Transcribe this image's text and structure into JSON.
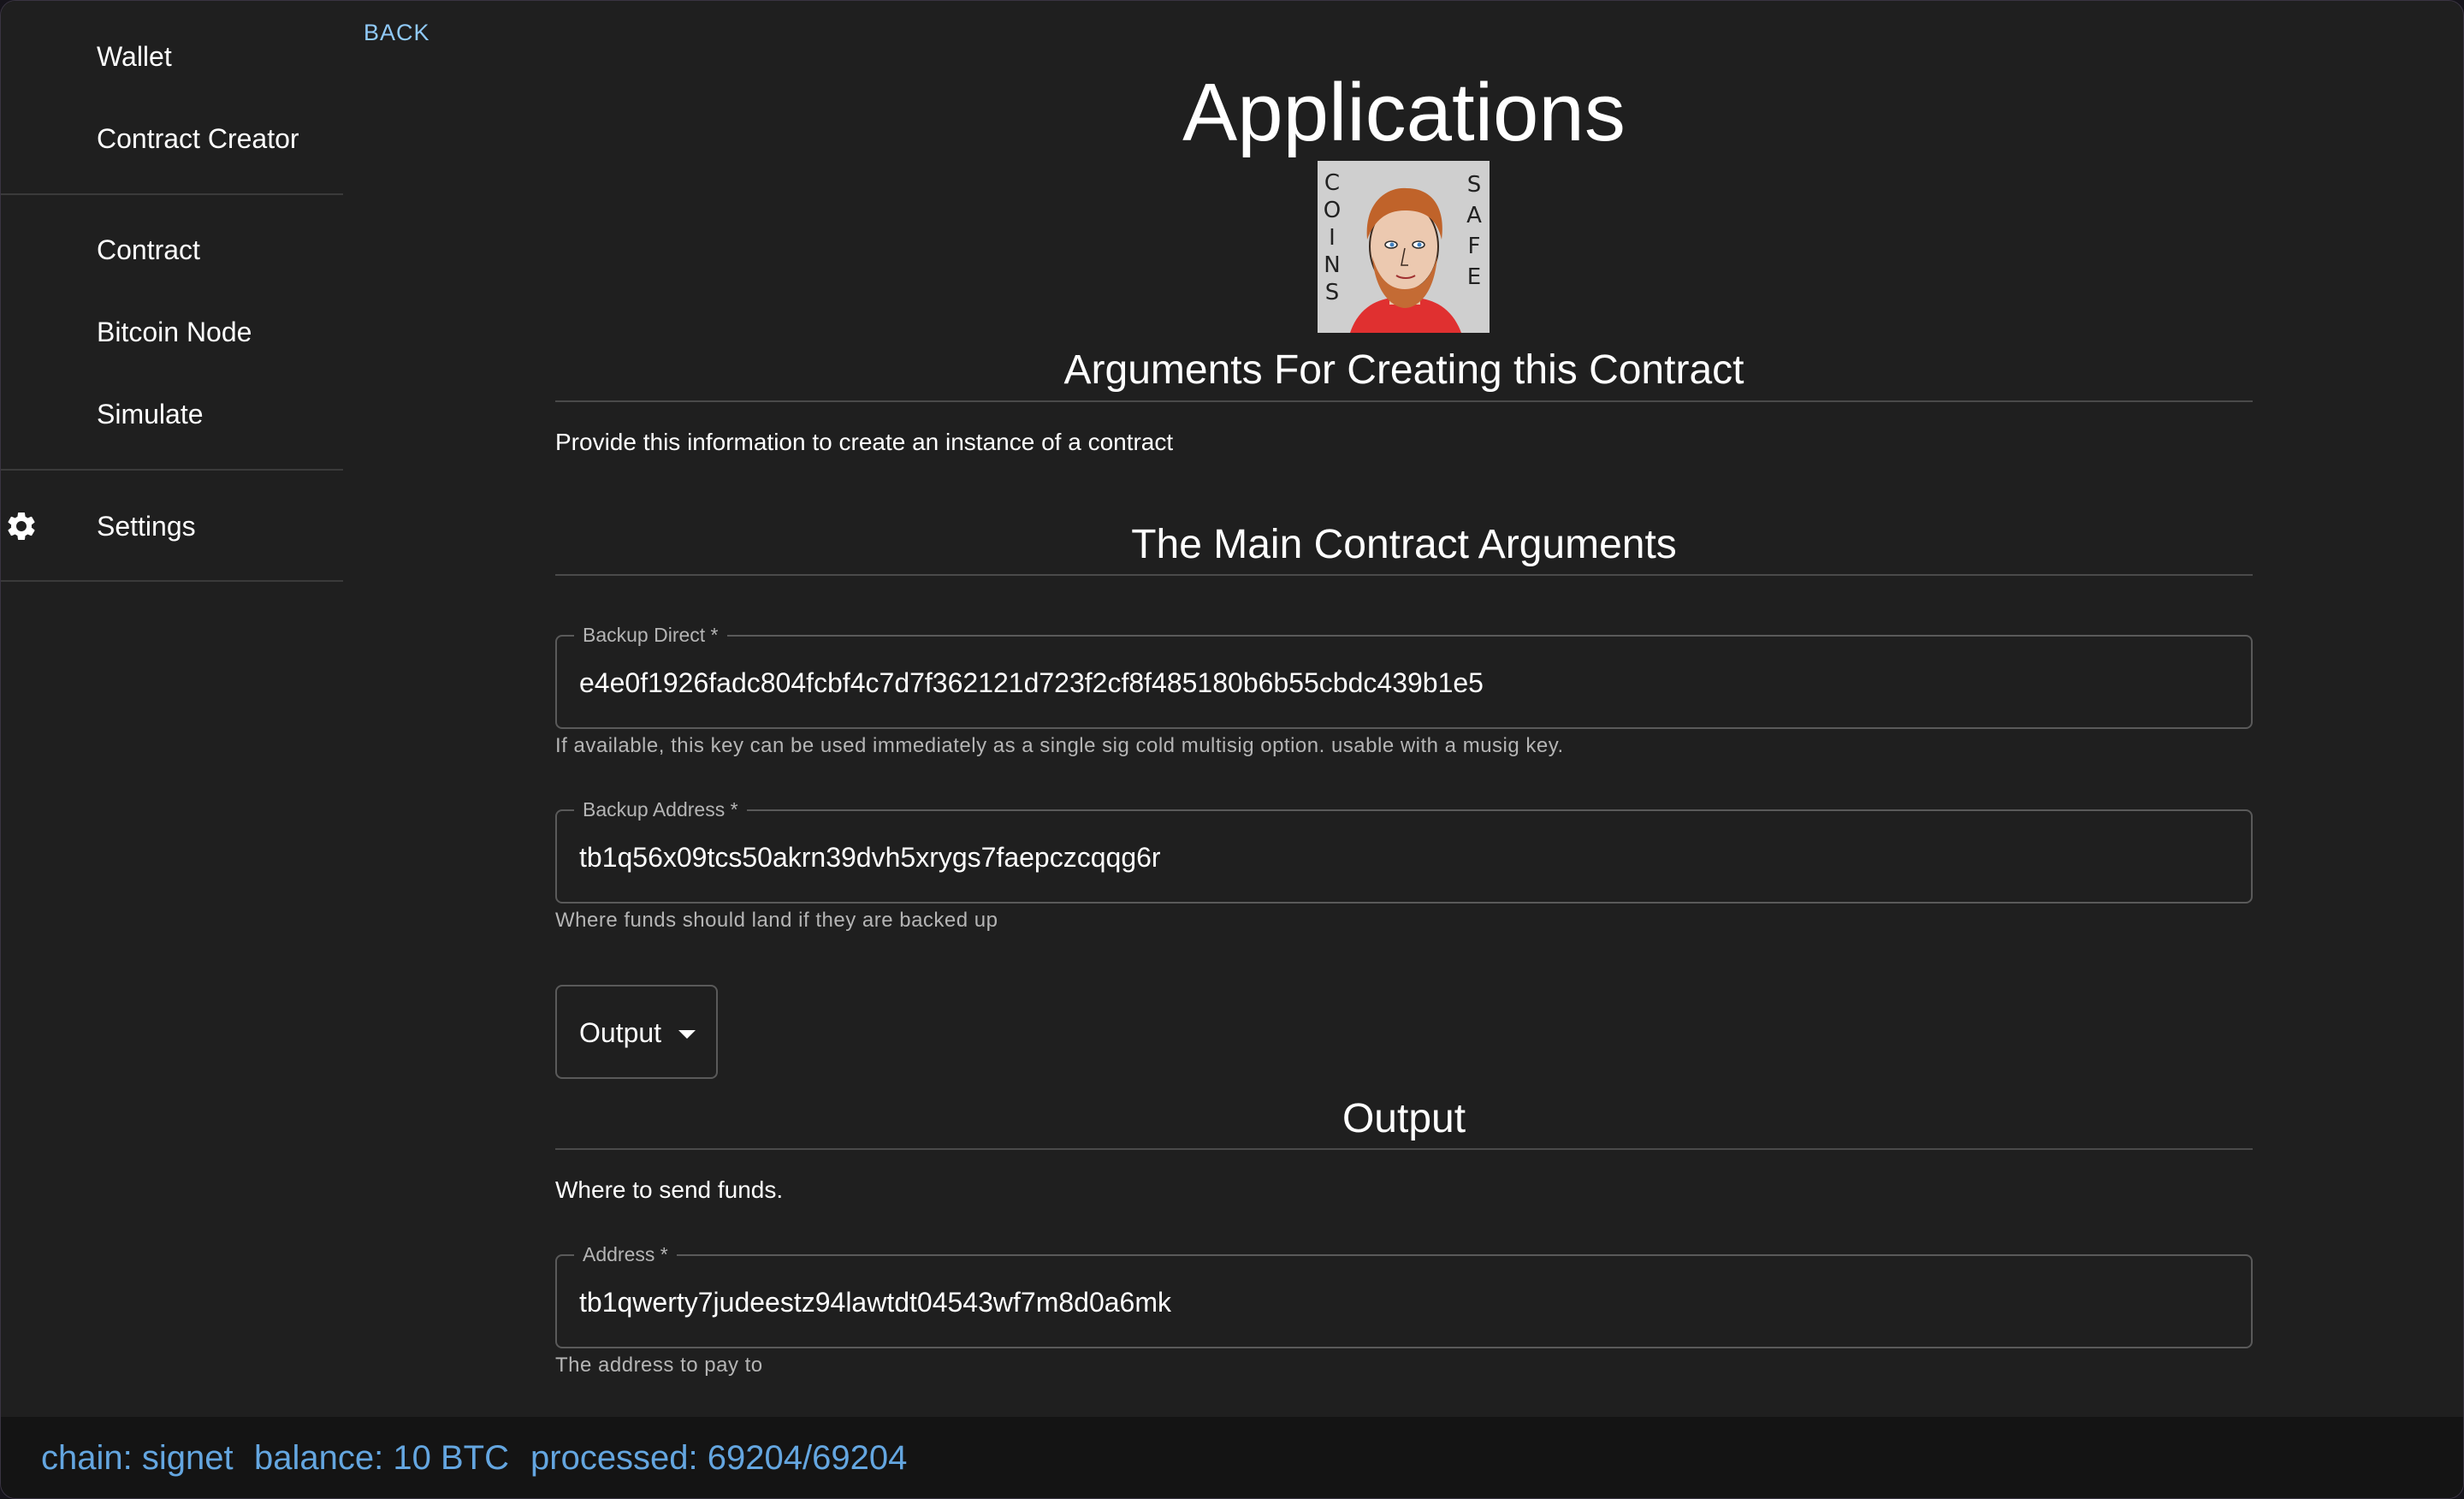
{
  "sidebar": {
    "items": [
      {
        "label": "Wallet"
      },
      {
        "label": "Contract Creator"
      },
      {
        "label": "Contract"
      },
      {
        "label": "Bitcoin Node"
      },
      {
        "label": "Simulate"
      },
      {
        "label": "Settings",
        "icon": "gear-icon"
      }
    ]
  },
  "nav": {
    "back_label": "BACK"
  },
  "page": {
    "title": "Applications",
    "logo": {
      "left_text": [
        "C",
        "O",
        "I",
        "N",
        "S"
      ],
      "right_text": [
        "S",
        "A",
        "F",
        "E"
      ]
    }
  },
  "form": {
    "section_title": "Arguments For Creating this Contract",
    "section_description": "Provide this information to create an instance of a contract",
    "main_args_title": "The Main Contract Arguments",
    "fields": [
      {
        "label": "Backup Direct *",
        "value": "e4e0f1926fadc804fcbf4c7d7f362121d723f2cf8f485180b6b55cbdc439b1e5",
        "helper": "If available, this key can be used immediately as a single sig cold multisig option. usable with a musig key."
      },
      {
        "label": "Backup Address *",
        "value": "tb1q56x09tcs50akrn39dvh5xrygs7faepczcqqg6r",
        "helper": "Where funds should land if they are backed up"
      }
    ],
    "select": {
      "value": "Output"
    },
    "output": {
      "title": "Output",
      "description": "Where to send funds.",
      "field": {
        "label": "Address *",
        "value": "tb1qwerty7judeestz94lawtdt04543wf7m8d0a6mk",
        "helper": "The address to pay to"
      }
    }
  },
  "status": {
    "chain": "chain: signet",
    "balance": "balance: 10 BTC",
    "processed": "processed: 69204/69204",
    "color": "#64a6e0"
  }
}
